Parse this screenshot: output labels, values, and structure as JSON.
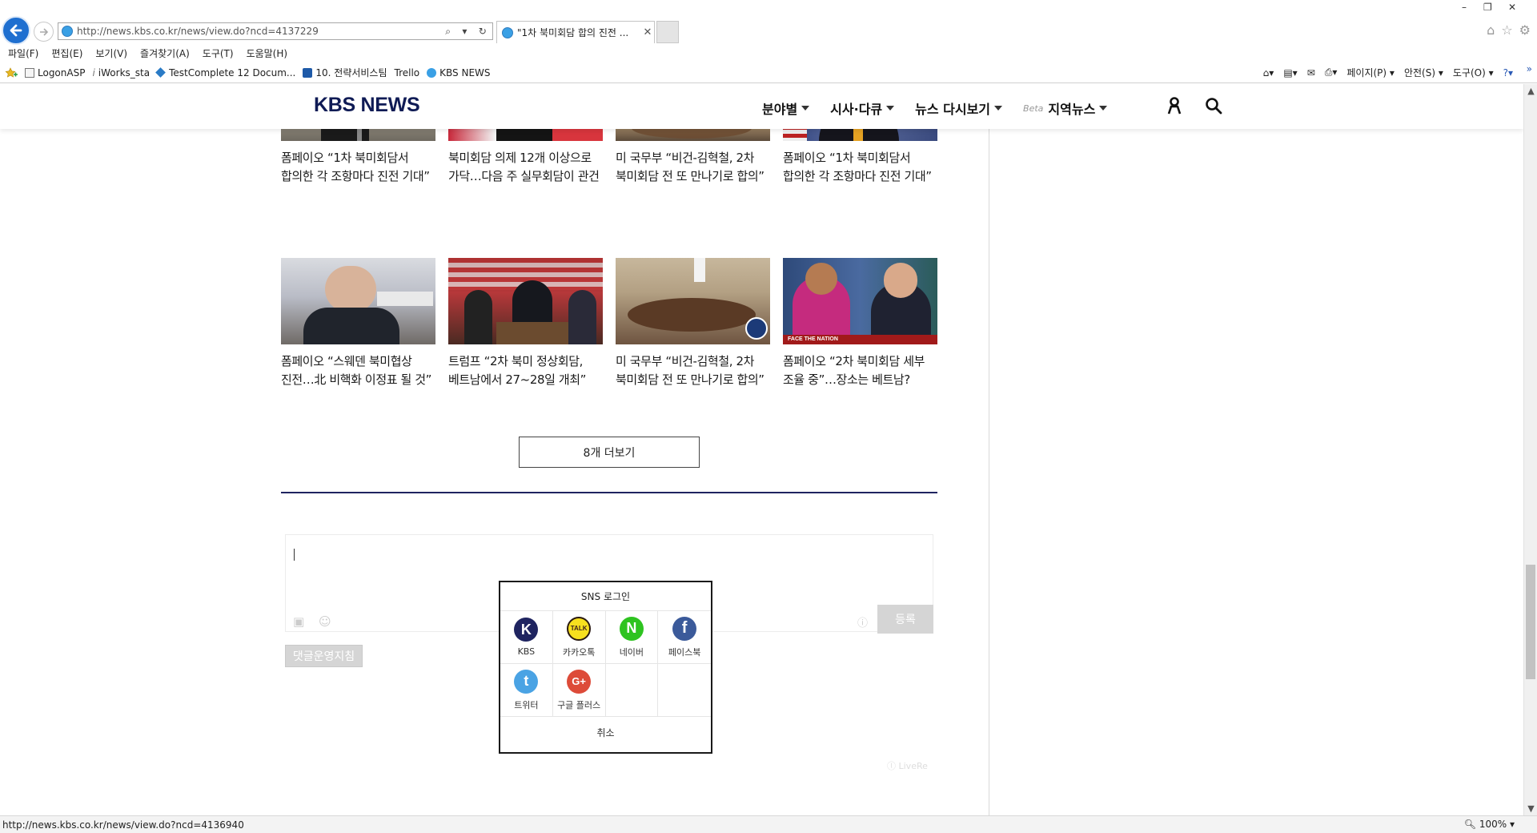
{
  "browser": {
    "url": "http://news.kbs.co.kr/news/view.do?ncd=4137229",
    "tab_title": "\"1차 북미회담 합의 진전 ...",
    "menu": [
      "파일(F)",
      "편집(E)",
      "보기(V)",
      "즐겨찾기(A)",
      "도구(T)",
      "도움말(H)"
    ],
    "favorites": [
      "LogonASP",
      "iWorks_sta",
      "TestComplete 12 Docum...",
      "10. 전략서비스팀",
      "Trello",
      "KBS NEWS"
    ],
    "commands": [
      "페이지(P)",
      "안전(S)",
      "도구(O)"
    ],
    "status_url": "http://news.kbs.co.kr/news/view.do?ncd=4136940",
    "zoom": "100%"
  },
  "kbs": {
    "logo": "KBS NEWS",
    "nav": [
      "분야별",
      "시사·다큐",
      "뉴스 다시보기"
    ],
    "beta": "Beta",
    "regional": "지역뉴스"
  },
  "articles_row1": [
    {
      "title": "폼페이오 “1차 북미회담서 합의한 각 조항마다 진전 기대”"
    },
    {
      "title": "북미회담 의제 12개 이상으로 가닥…다음 주 실무회담이 관건"
    },
    {
      "title": "미 국무부 “비건-김혁철, 2차 북미회담 전 또 만나기로 합의”"
    },
    {
      "title": "폼페이오 “1차 북미회담서 합의한 각 조항마다 진전 기대”"
    }
  ],
  "articles_row2": [
    {
      "title": "폼페이오 “스웨덴 북미협상 진전…北 비핵화 이정표 될 것”"
    },
    {
      "title": "트럼프 “2차 북미 정상회담, 베트남에서 27~28일 개최”"
    },
    {
      "title": "미 국무부 “비건-김혁철, 2차 북미회담 전 또 만나기로 합의”"
    },
    {
      "title": "폼페이오 “2차 북미회담 세부 조율 중”…장소는 베트남?"
    }
  ],
  "thumb_overlay_text": "FACE THE NATION",
  "more_button": "8개 더보기",
  "comment": {
    "register": "등록",
    "policy": "댓글운영지침",
    "powered": "LiveRe"
  },
  "sns_login": {
    "title": "SNS 로그인",
    "providers": [
      {
        "name": "KBS",
        "glyph": "K",
        "color": "#1f2460"
      },
      {
        "name": "카카오톡",
        "glyph": "TALK",
        "color": "#f7e01e"
      },
      {
        "name": "네이버",
        "glyph": "N",
        "color": "#2ec320"
      },
      {
        "name": "페이스북",
        "glyph": "f",
        "color": "#3b5a9a"
      },
      {
        "name": "트위터",
        "glyph": "t",
        "color": "#4aa3e4"
      },
      {
        "name": "구글 플러스",
        "glyph": "G+",
        "color": "#dd4b39"
      }
    ],
    "cancel": "취소"
  }
}
